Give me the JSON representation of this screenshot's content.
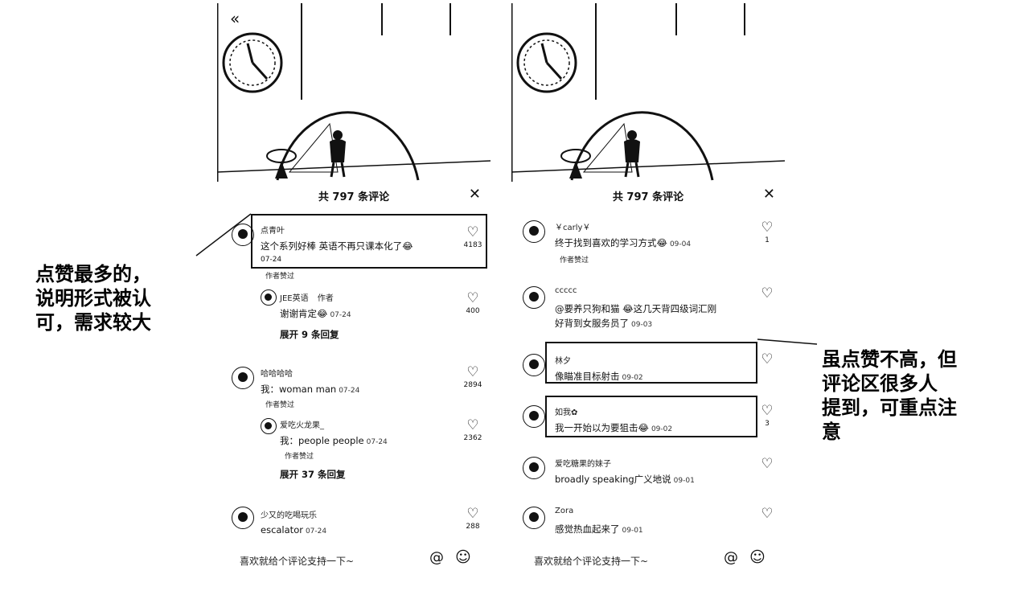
{
  "annotations": {
    "left_lines": [
      "点赞最多的，",
      "说明形式被认",
      "可，需求较大"
    ],
    "right_lines": [
      "虽点赞不高，但",
      "评论区很多人",
      "提到，可重点注",
      "意"
    ]
  },
  "screens": [
    {
      "header": {
        "title": "共 797 条评论",
        "close_icon": "close-icon"
      },
      "comments": [
        {
          "name": "点青叶",
          "text": "这个系列好棒 英语不再只课本化了",
          "emoji": "😂",
          "date": "07-24",
          "likes": "4183",
          "tag": "作者赞过"
        },
        {
          "name": "JEE英语",
          "author_badge": "作者",
          "text": "谢谢肯定",
          "emoji": "😂",
          "date": "07-24",
          "likes": "400",
          "expand": "展开 9 条回复"
        },
        {
          "name": "哈哈哈哈",
          "text": "我：woman man",
          "date": "07-24",
          "likes": "2894",
          "tag": "作者赞过"
        },
        {
          "name": "爱吃火龙果_",
          "text": "我：people people",
          "date": "07-24",
          "likes": "2362",
          "tag": "作者赞过",
          "expand": "展开 37 条回复"
        },
        {
          "name": "少又的吃喝玩乐",
          "text": "escalator",
          "date": "07-24",
          "likes": "288"
        }
      ],
      "input": {
        "placeholder": "喜欢就给个评论支持一下~",
        "at": "@",
        "emoji": "☺"
      }
    },
    {
      "header": {
        "title": "共 797 条评论",
        "close_icon": "close-icon"
      },
      "comments": [
        {
          "name": "￥carly￥",
          "text": "终于找到喜欢的学习方式",
          "emoji": "😂",
          "date": "09-04",
          "likes": "1",
          "tag": "作者赞过"
        },
        {
          "name": "ccccc",
          "text_line1": "@要养只狗和猫 😂这几天背四级词汇刚",
          "text_line2": "好背到女服务员了",
          "date": "09-03",
          "likes": ""
        },
        {
          "name": "林夕",
          "text": "像瞄准目标射击",
          "date": "09-02",
          "likes": ""
        },
        {
          "name": "如我✿",
          "text": "我一开始以为要狙击",
          "emoji": "😂",
          "date": "09-02",
          "likes": "3"
        },
        {
          "name": "爱吃糖果的妹子",
          "text": "broadly speaking广义地说",
          "date": "09-01",
          "likes": ""
        },
        {
          "name": "Zora",
          "text": "感觉热血起来了",
          "date": "09-01",
          "likes": ""
        }
      ],
      "input": {
        "placeholder": "喜欢就给个评论支持一下~",
        "at": "@",
        "emoji": "☺"
      }
    }
  ]
}
